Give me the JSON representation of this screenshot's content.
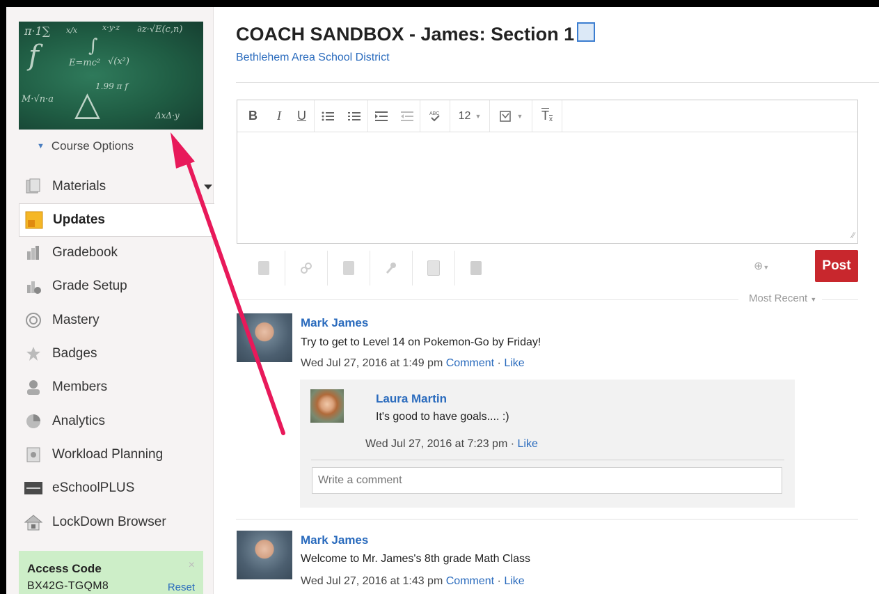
{
  "sidebar": {
    "banner_glyphs": [
      "π·1∑",
      "x/x",
      "x·y·z",
      "∂z·√E(c,n)",
      "f",
      "E=mc²",
      "√(x²)",
      "∫",
      "1.99 π f",
      "△",
      "M·√n·a",
      "ΔxΔ·y"
    ],
    "course_options": "Course Options",
    "items": [
      {
        "label": "Materials",
        "icon": "materials-icon"
      },
      {
        "label": "Updates",
        "icon": "updates-icon",
        "active": true
      },
      {
        "label": "Gradebook",
        "icon": "gradebook-icon"
      },
      {
        "label": "Grade Setup",
        "icon": "grade-setup-icon"
      },
      {
        "label": "Mastery",
        "icon": "mastery-icon"
      },
      {
        "label": "Badges",
        "icon": "badges-icon"
      },
      {
        "label": "Members",
        "icon": "members-icon"
      },
      {
        "label": "Analytics",
        "icon": "analytics-icon"
      },
      {
        "label": "Workload Planning",
        "icon": "workload-icon"
      },
      {
        "label": "eSchoolPLUS",
        "icon": "eschoolplus-icon"
      },
      {
        "label": "LockDown Browser",
        "icon": "lockdown-icon"
      }
    ],
    "access": {
      "title": "Access Code",
      "code": "BX42G-TGQM8",
      "reset": "Reset",
      "close": "×"
    }
  },
  "header": {
    "title": "COACH SANDBOX - James: Section 1",
    "subtitle": "Bethlehem Area School District"
  },
  "editor": {
    "toolbar": {
      "bold": "B",
      "italic": "I",
      "underline": "U",
      "font_size": "12",
      "clear": "T"
    },
    "post_label": "Post",
    "sort_label": "Most Recent"
  },
  "posts": [
    {
      "author": "Mark James",
      "text": "Try to get to Level 14 on Pokemon-Go by Friday!",
      "date": "Wed Jul 27, 2016 at 1:49 pm",
      "comment": "Comment",
      "like": "Like",
      "reply": {
        "author": "Laura Martin",
        "text": "It's good to have goals.... :)",
        "date": "Wed Jul 27, 2016 at 7:23 pm",
        "like": "Like"
      },
      "comment_placeholder": "Write a comment"
    },
    {
      "author": "Mark James",
      "text": "Welcome to Mr. James's 8th grade Math Class",
      "date": "Wed Jul 27, 2016 at 1:43 pm",
      "comment": "Comment",
      "like": "Like"
    }
  ],
  "colors": {
    "link": "#2a6bbd",
    "post_button": "#c8272d",
    "arrow": "#e8195a",
    "access_bg": "#cdeec8"
  }
}
